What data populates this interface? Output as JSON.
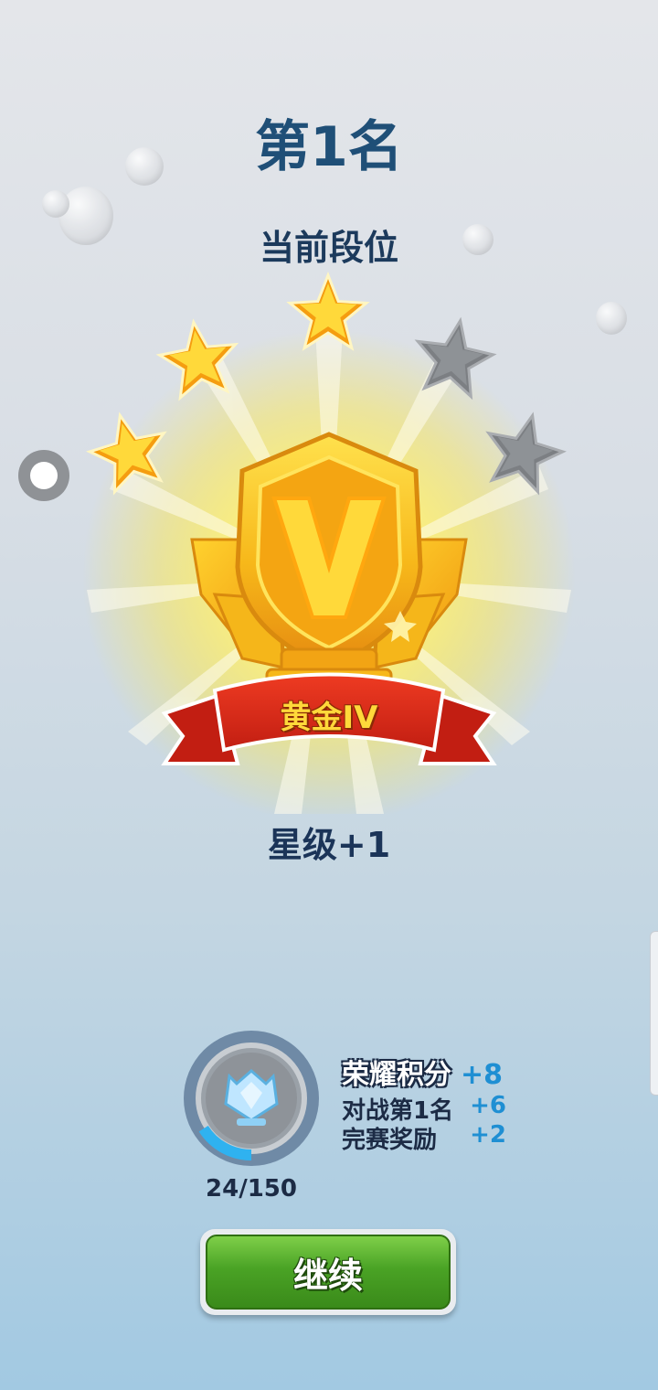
{
  "header": {
    "rank_title": "第1名",
    "current_tier_label": "当前段位"
  },
  "badge": {
    "tier_name": "黄金IV",
    "stars_total": 5,
    "stars_filled": 3
  },
  "star_change": "星级+1",
  "rewards": {
    "honor_label": "荣耀积分",
    "honor_value": "+8",
    "items": [
      {
        "label": "对战第1名",
        "value": "+6"
      },
      {
        "label": "完赛奖励",
        "value": "+2"
      }
    ]
  },
  "progress": {
    "text": "24/150",
    "fraction": 0.16
  },
  "buttons": {
    "continue": "继续"
  },
  "colors": {
    "title": "#1f4f77",
    "gold": "#f7c21f",
    "ribbon_red": "#d8291a",
    "button_green": "#4aa325",
    "reward_blue": "#1f8fd3"
  }
}
